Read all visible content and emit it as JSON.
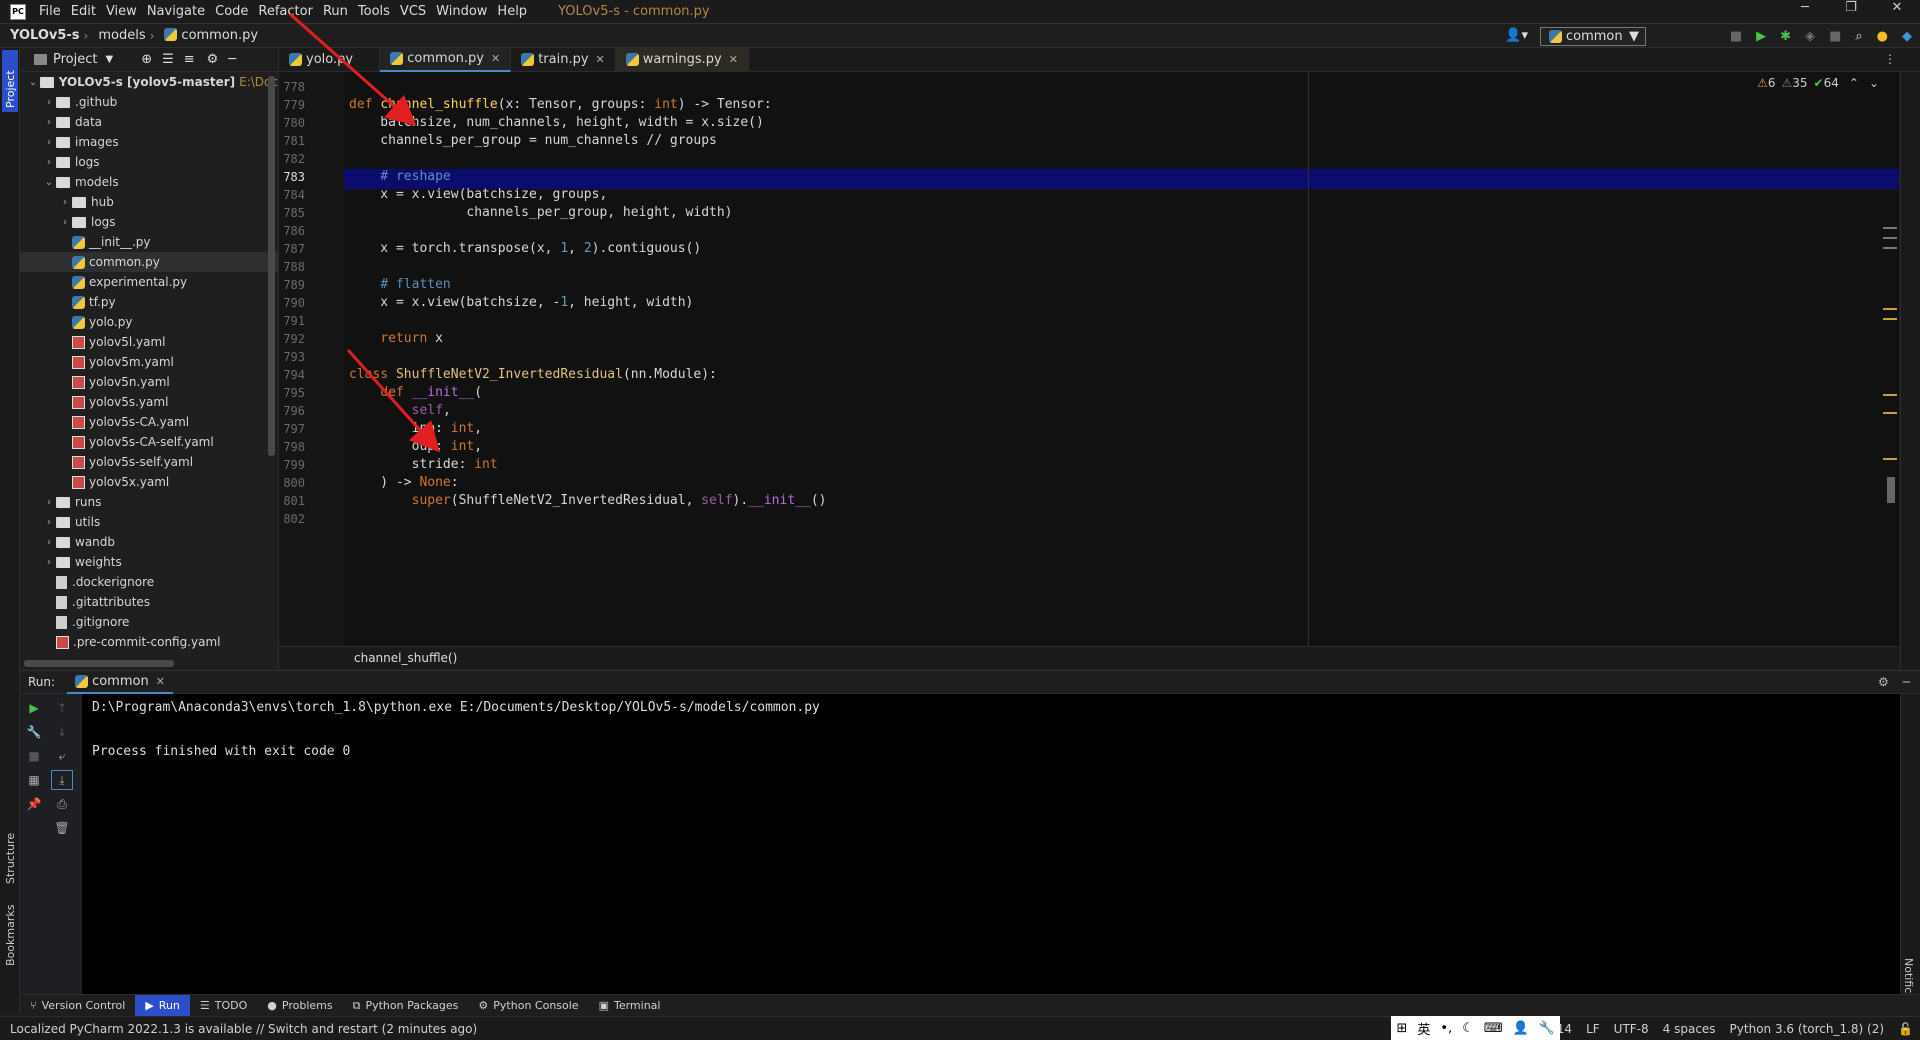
{
  "menubar": {
    "logo": "PC",
    "items": [
      "File",
      "Edit",
      "View",
      "Navigate",
      "Code",
      "Refactor",
      "Run",
      "Tools",
      "VCS",
      "Window",
      "Help"
    ],
    "title": "YOLOv5-s - common.py"
  },
  "navbar": {
    "crumbs": [
      "YOLOv5-s",
      "models",
      "common.py"
    ],
    "run_config": "common"
  },
  "project": {
    "header": "Project",
    "tree": [
      {
        "label": "YOLOv5-s [yolov5-master]",
        "extra": "E:\\Doc",
        "indent": 0,
        "type": "root",
        "open": true
      },
      {
        "label": ".github",
        "indent": 1,
        "type": "folder"
      },
      {
        "label": "data",
        "indent": 1,
        "type": "folder"
      },
      {
        "label": "images",
        "indent": 1,
        "type": "folder"
      },
      {
        "label": "logs",
        "indent": 1,
        "type": "folder"
      },
      {
        "label": "models",
        "indent": 1,
        "type": "folder",
        "open": true
      },
      {
        "label": "hub",
        "indent": 2,
        "type": "folder"
      },
      {
        "label": "logs",
        "indent": 2,
        "type": "folder"
      },
      {
        "label": "__init__.py",
        "indent": 2,
        "type": "py"
      },
      {
        "label": "common.py",
        "indent": 2,
        "type": "py",
        "selected": true
      },
      {
        "label": "experimental.py",
        "indent": 2,
        "type": "py"
      },
      {
        "label": "tf.py",
        "indent": 2,
        "type": "py"
      },
      {
        "label": "yolo.py",
        "indent": 2,
        "type": "py"
      },
      {
        "label": "yolov5l.yaml",
        "indent": 2,
        "type": "yaml"
      },
      {
        "label": "yolov5m.yaml",
        "indent": 2,
        "type": "yaml"
      },
      {
        "label": "yolov5n.yaml",
        "indent": 2,
        "type": "yaml"
      },
      {
        "label": "yolov5s.yaml",
        "indent": 2,
        "type": "yaml"
      },
      {
        "label": "yolov5s-CA.yaml",
        "indent": 2,
        "type": "yaml"
      },
      {
        "label": "yolov5s-CA-self.yaml",
        "indent": 2,
        "type": "yaml"
      },
      {
        "label": "yolov5s-self.yaml",
        "indent": 2,
        "type": "yaml"
      },
      {
        "label": "yolov5x.yaml",
        "indent": 2,
        "type": "yaml"
      },
      {
        "label": "runs",
        "indent": 1,
        "type": "folder"
      },
      {
        "label": "utils",
        "indent": 1,
        "type": "folder"
      },
      {
        "label": "wandb",
        "indent": 1,
        "type": "folder"
      },
      {
        "label": "weights",
        "indent": 1,
        "type": "folder"
      },
      {
        "label": ".dockerignore",
        "indent": 1,
        "type": "file"
      },
      {
        "label": ".gitattributes",
        "indent": 1,
        "type": "file"
      },
      {
        "label": ".gitignore",
        "indent": 1,
        "type": "file"
      },
      {
        "label": ".pre-commit-config.yaml",
        "indent": 1,
        "type": "yaml"
      }
    ]
  },
  "tabs": [
    {
      "label": "yolo.py",
      "closable": false
    },
    {
      "label": "common.py",
      "closable": true,
      "active": true
    },
    {
      "label": "train.py",
      "closable": true
    },
    {
      "label": "warnings.py",
      "closable": true
    }
  ],
  "inspections": {
    "warnings": "6",
    "weak": "35",
    "ok": "64"
  },
  "editor": {
    "current_line": "783",
    "lines": [
      {
        "n": "778",
        "html": ""
      },
      {
        "n": "779",
        "html": "<span class='kw'>def</span> <span class='fn'>channel_shuffle</span>(x: Tensor, groups: <span class='kw'>int</span>) -> Tensor:"
      },
      {
        "n": "780",
        "html": "    batchsize, num_channels, height, width = x.size()"
      },
      {
        "n": "781",
        "html": "    channels_per_group = num_channels // groups"
      },
      {
        "n": "782",
        "html": ""
      },
      {
        "n": "783",
        "html": "    <span class='cm'># reshape</span>"
      },
      {
        "n": "784",
        "html": "    x = x.view(batchsize, groups,"
      },
      {
        "n": "785",
        "html": "               channels_per_group, height, width)"
      },
      {
        "n": "786",
        "html": ""
      },
      {
        "n": "787",
        "html": "    x = torch.transpose(x, <span class='num'>1</span>, <span class='num'>2</span>).contiguous()"
      },
      {
        "n": "788",
        "html": ""
      },
      {
        "n": "789",
        "html": "    <span class='cm'># flatten</span>"
      },
      {
        "n": "790",
        "html": "    x = x.view(batchsize, -<span class='num'>1</span>, height, width)"
      },
      {
        "n": "791",
        "html": ""
      },
      {
        "n": "792",
        "html": "    <span class='kw'>return</span> x"
      },
      {
        "n": "793",
        "html": ""
      },
      {
        "n": "794",
        "html": "<span class='kw'>class</span> <span class='cls'>ShuffleNetV2_InvertedResidual</span>(nn.Module):"
      },
      {
        "n": "795",
        "html": "    <span class='kw'>def</span> <span class='dun'>__init__</span>("
      },
      {
        "n": "796",
        "html": "        <span class='self'>self</span>,"
      },
      {
        "n": "797",
        "html": "        inp: <span class='kw'>int</span>,"
      },
      {
        "n": "798",
        "html": "        oup: <span class='kw'>int</span>,"
      },
      {
        "n": "799",
        "html": "        stride: <span class='kw'>int</span>"
      },
      {
        "n": "800",
        "html": "    ) -> <span class='kw'>None</span>:"
      },
      {
        "n": "801",
        "html": "        <span class='kw'>super</span>(ShuffleNetV2_InvertedResidual, <span class='self'>self</span>).<span class='dun'>__init__</span>()"
      },
      {
        "n": "802",
        "html": ""
      }
    ]
  },
  "code_breadcrumb": "channel_shuffle()",
  "run": {
    "label": "Run:",
    "tab": "common",
    "console": [
      "D:\\Program\\Anaconda3\\envs\\torch_1.8\\python.exe E:/Documents/Desktop/YOLOv5-s/models/common.py",
      "",
      "Process finished with exit code 0"
    ]
  },
  "tooltabs": [
    "Version Control",
    "Run",
    "TODO",
    "Problems",
    "Python Packages",
    "Python Console",
    "Terminal"
  ],
  "status": {
    "message": "Localized PyCharm 2022.1.3 is available // Switch and restart (2 minutes ago)",
    "position": "783:14",
    "line_sep": "LF",
    "encoding": "UTF-8",
    "indent": "4 spaces",
    "interpreter": "Python 3.6 (torch_1.8) (2)",
    "ime": "英"
  },
  "side_labels": {
    "project": "Project",
    "structure": "Structure",
    "bookmarks": "Bookmarks",
    "notifications": "Notifications"
  },
  "colors": {
    "accent": "#2c4fc7",
    "current_line": "#0c0c6e",
    "arrow": "#e02020"
  }
}
